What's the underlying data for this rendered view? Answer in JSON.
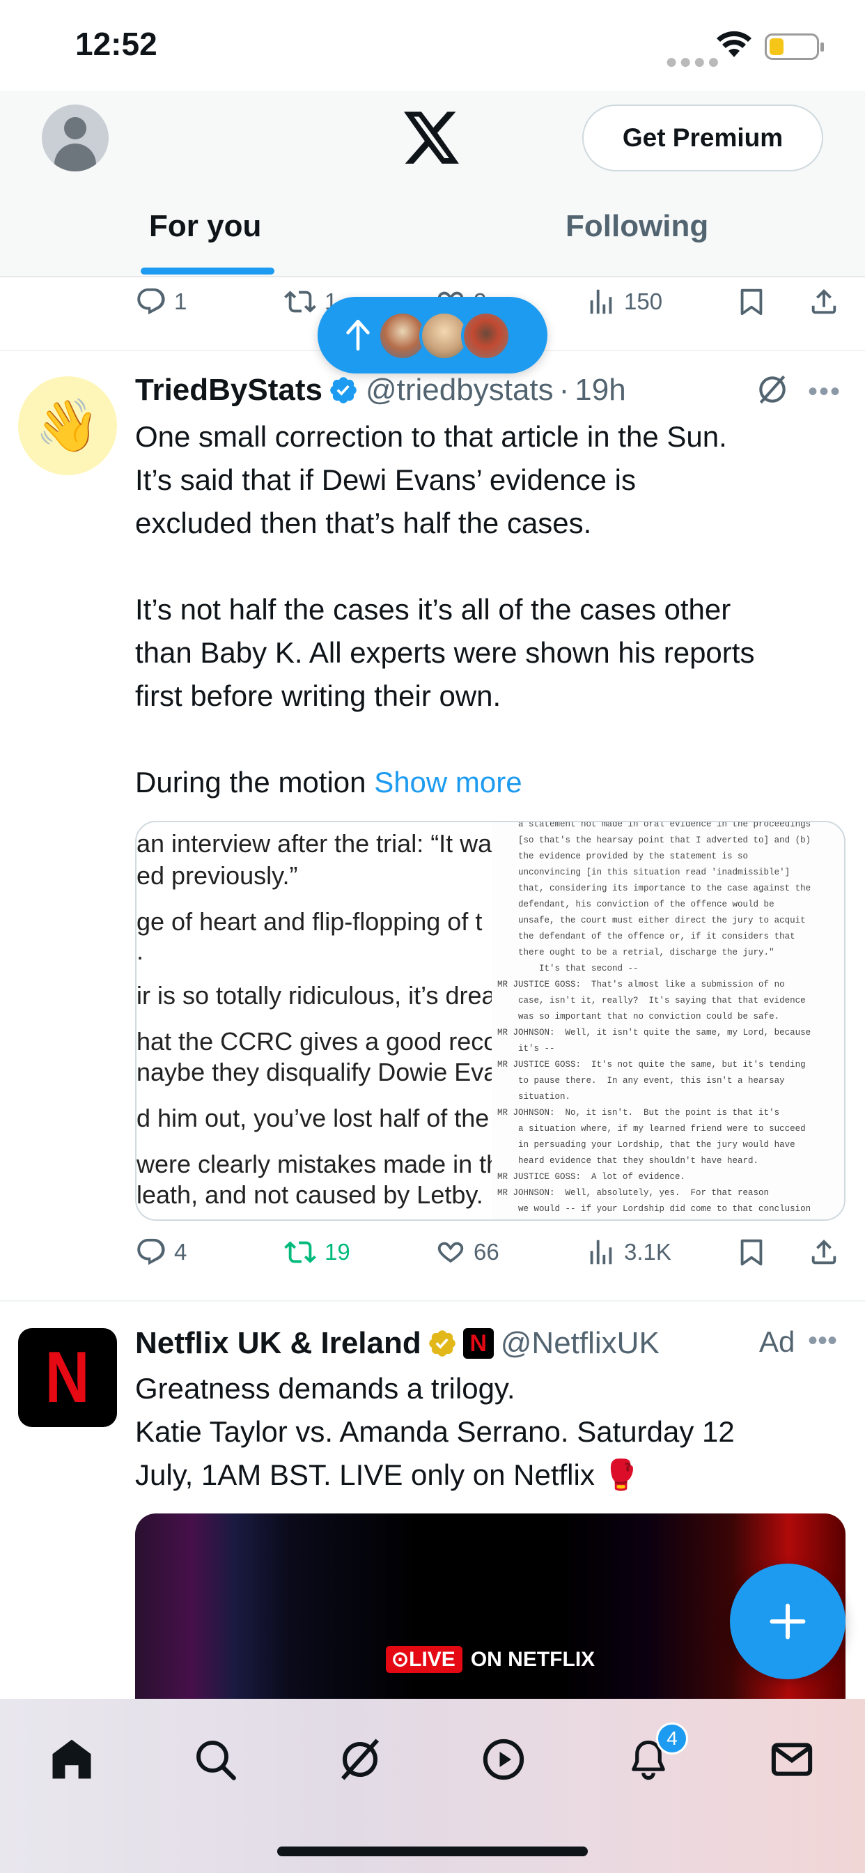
{
  "status_bar": {
    "time": "12:52"
  },
  "header": {
    "premium_label": "Get Premium",
    "tabs": [
      {
        "label": "For you"
      },
      {
        "label": "Following"
      }
    ]
  },
  "prev_tweet_actions": {
    "replies": "1",
    "retweets": "1",
    "likes": "2",
    "views": "150"
  },
  "tweet": {
    "name": "TriedByStats",
    "handle": "@triedbystats",
    "sep": "·",
    "time": "19h",
    "avatar_emoji": "👋",
    "body_p1": "One small correction to that article in the Sun.\nIt’s said that if Dewi Evans’ evidence is\nexcluded then that’s half the cases.",
    "body_p2": "It’s not half the cases it’s all of the cases other\nthan Baby K. All experts were shown his reports\nfirst before writing their own.",
    "body_p3": "During the motion ",
    "show_more": "Show more",
    "media_left_lines": [
      "an interview after the trial: “It wa",
      "ed previously.”",
      "ge of heart and flip-flopping of t",
      ".",
      "ir is so totally ridiculous, it’s drea",
      "hat the CCRC gives a good recon",
      "naybe they disqualify Dowie Evan",
      "d him out, you’ve lost half of the",
      "were clearly mistakes made in th",
      "leath, and not caused by Letby."
    ],
    "media_right_lines": [
      "    a statement not made in oral evidence in the proceedings",
      "    [so that's the hearsay point that I adverted to] and (b)",
      "    the evidence provided by the statement is so",
      "    unconvincing [in this situation read 'inadmissible']",
      "    that, considering its importance to the case against the",
      "    defendant, his conviction of the offence would be",
      "    unsafe, the court must either direct the jury to acquit",
      "    the defendant of the offence or, if it considers that",
      "    there ought to be a retrial, discharge the jury.\"",
      "        It's that second --",
      "MR JUSTICE GOSS:  That's almost like a submission of no",
      "    case, isn't it, really?  It's saying that that evidence",
      "    was so important that no conviction could be safe.",
      "MR JOHNSON:  Well, it isn't quite the same, my Lord, because",
      "    it's --",
      "MR JUSTICE GOSS:  It's not quite the same, but it's tending",
      "    to pause there.  In any event, this isn't a hearsay",
      "    situation.",
      "MR JOHNSON:  No, it isn't.  But the point is that it's",
      "    a situation where, if my learned friend were to succeed",
      "    in persuading your Lordship, that the jury would have",
      "    heard evidence that they shouldn't have heard.",
      "MR JUSTICE GOSS:  A lot of evidence.",
      "MR JOHNSON:  Well, absolutely, yes.  For that reason",
      "    we would -- if your Lordship did come to that conclusion"
    ],
    "actions": {
      "replies": "4",
      "retweets": "19",
      "likes": "66",
      "views": "3.1K"
    }
  },
  "ad": {
    "name": "Netflix UK & Ireland",
    "handle": "@NetflixUK",
    "ad_label": "Ad",
    "logo_letter": "N",
    "body": "Greatness demands a trilogy.\nKatie Taylor vs. Amanda Serrano. Saturday 12\nJuly, 1AM BST. LIVE only on Netflix 🥊",
    "media_live": "LIVE",
    "media_on": "ON NETFLIX"
  },
  "bottom_nav": {
    "notification_count": "4"
  },
  "colors": {
    "accent": "#1d9bf0",
    "retweet_green": "#00ba7c",
    "netflix_red": "#e50914"
  }
}
